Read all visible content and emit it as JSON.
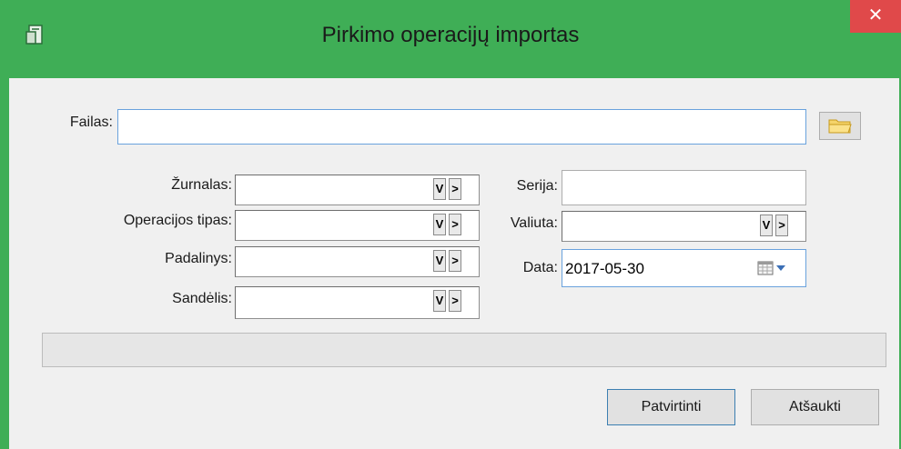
{
  "window": {
    "title": "Pirkimo operacijų importas",
    "close_glyph": "✕"
  },
  "file": {
    "label": "Failas:",
    "value": ""
  },
  "fields": {
    "zurnalas": {
      "label": "Žurnalas:",
      "value": ""
    },
    "operacijos_tipas": {
      "label": "Operacijos tipas:",
      "value": ""
    },
    "padalinys": {
      "label": "Padalinys:",
      "value": ""
    },
    "sandelis": {
      "label": "Sandėlis:",
      "value": ""
    },
    "serija": {
      "label": "Serija:",
      "value": ""
    },
    "valiuta": {
      "label": "Valiuta:",
      "value": ""
    },
    "data": {
      "label": "Data:",
      "value": "2017-05-30"
    }
  },
  "combo_glyphs": {
    "filter": "V",
    "next": ">"
  },
  "buttons": {
    "confirm": "Patvirtinti",
    "cancel": "Atšaukti"
  },
  "colors": {
    "titlebar": "#3fae56",
    "close": "#e0494a",
    "accent_border": "#6aa2dd"
  },
  "icons": [
    "app-icon",
    "close-icon",
    "folder-icon",
    "filter-icon",
    "next-icon",
    "calendar-icon",
    "dropdown-arrow-icon"
  ]
}
